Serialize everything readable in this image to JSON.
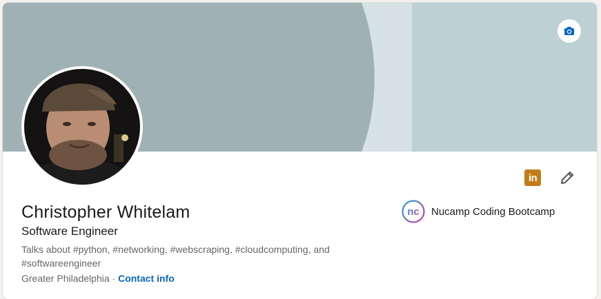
{
  "profile": {
    "name": "Christopher Whitelam",
    "headline": "Software Engineer",
    "talks_about": "Talks about #python, #networking, #webscraping, #cloudcomputing, and #softwareengineer",
    "location": "Greater Philadelphia",
    "separator": "·",
    "contact_label": "Contact info"
  },
  "company": {
    "name": "Nucamp Coding Bootcamp",
    "logo_text": "nc"
  },
  "actions": {
    "linkedin_badge": "in"
  },
  "icons": {
    "cover_camera": "camera-icon",
    "edit": "pencil-icon",
    "linkedin": "linkedin-icon",
    "company_logo": "nucamp-logo"
  },
  "colors": {
    "cover_dark": "#a0b1b5",
    "cover_mid": "#d7e2e4",
    "cover_light": "#bdd0d4",
    "link_blue": "#0a66c2",
    "linkedin_gold": "#c37d16"
  }
}
